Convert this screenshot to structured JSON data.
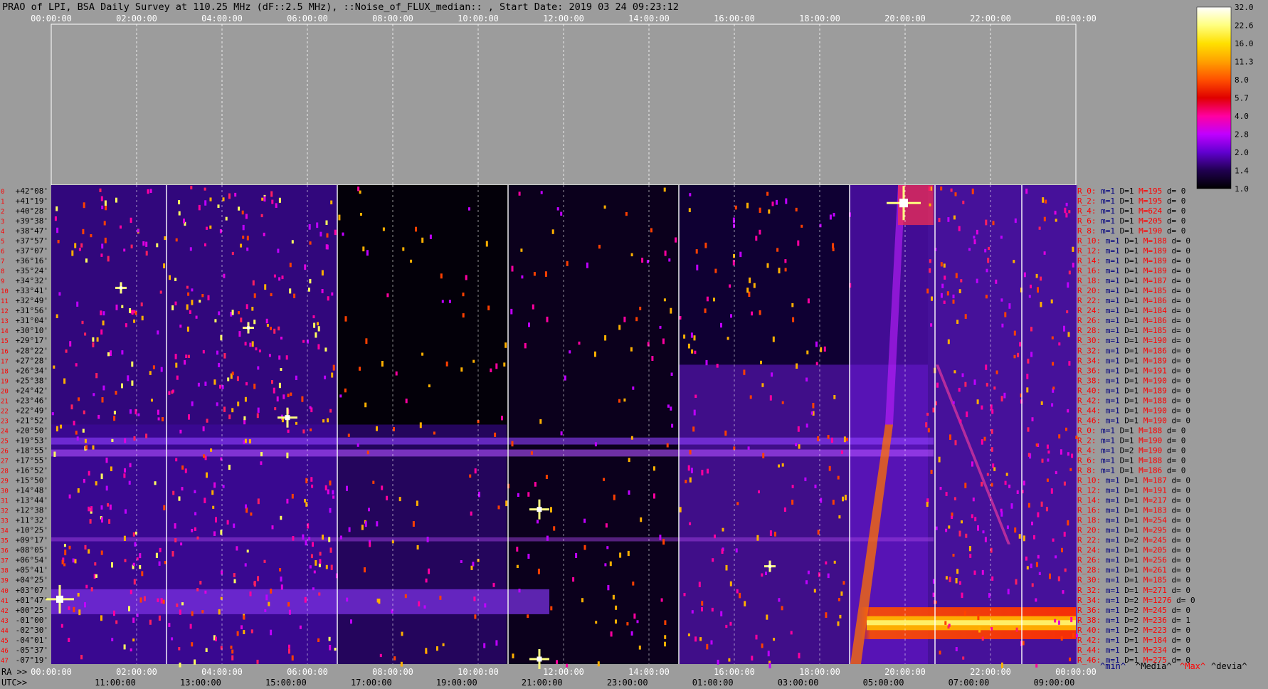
{
  "chart_data": {
    "type": "heatmap",
    "title": "PRAO of LPI, BSA Daily Survey at 110.25 MHz (dF::2.5 MHz), ::Noise_of_FLUX_median:: , Start Date: 2019 03 24 09:23:12",
    "top_ticks": [
      "00:00:00",
      "02:00:00",
      "04:00:00",
      "06:00:00",
      "08:00:00",
      "10:00:00",
      "12:00:00",
      "14:00:00",
      "16:00:00",
      "18:00:00",
      "20:00:00",
      "22:00:00",
      "00:00:00"
    ],
    "ra_prefix": "RA >>",
    "ra_ticks": [
      "00:00:00",
      "02:00:00",
      "04:00:00",
      "06:00:00",
      "08:00:00",
      "10:00:00",
      "12:00:00",
      "14:00:00",
      "16:00:00",
      "18:00:00",
      "20:00:00",
      "22:00:00",
      "00:00:00"
    ],
    "utc_prefix": "UTC>>",
    "utc_ticks": [
      "11:00:00",
      "13:00:00",
      "15:00:00",
      "17:00:00",
      "19:00:00",
      "21:00:00",
      "23:00:00",
      "01:00:00",
      "03:00:00",
      "05:00:00",
      "07:00:00",
      "09:00:00"
    ],
    "dec_labels": [
      "+42°08'",
      "+41°19'",
      "+40°28'",
      "+39°38'",
      "+38°47'",
      "+37°57'",
      "+37°07'",
      "+36°16'",
      "+35°24'",
      "+34°32'",
      "+33°41'",
      "+32°49'",
      "+31°56'",
      "+31°04'",
      "+30°10'",
      "+29°17'",
      "+28°22'",
      "+27°28'",
      "+26°34'",
      "+25°38'",
      "+24°42'",
      "+23°46'",
      "+22°49'",
      "+21°52'",
      "+20°50'",
      "+19°53'",
      "+18°55'",
      "+17°55'",
      "+16°52'",
      "+15°50'",
      "+14°48'",
      "+13°44'",
      "+12°38'",
      "+11°32'",
      "+10°25'",
      "+09°17'",
      "+08°05'",
      "+06°54'",
      "+05°41'",
      "+04°25'",
      "+03°07'",
      "+01°47'",
      "+00°25'",
      "-01°00'",
      "-02°30'",
      "-04°01'",
      "-05°37'",
      "-07°19'"
    ],
    "beam_numbers": [
      "0",
      "1",
      "2",
      "3",
      "4",
      "5",
      "6",
      "7",
      "8",
      "9",
      "10",
      "11",
      "12",
      "13",
      "14",
      "15",
      "16",
      "17",
      "18",
      "19",
      "20",
      "21",
      "22",
      "23",
      "24",
      "25",
      "26",
      "27",
      "28",
      "29",
      "30",
      "31",
      "32",
      "33",
      "34",
      "35",
      "36",
      "37",
      "38",
      "39",
      "40",
      "41",
      "42",
      "43",
      "44",
      "45",
      "46",
      "47"
    ],
    "colorbar": {
      "ticks": [
        "32.0",
        "22.6",
        "16.0",
        "11.3",
        "8.0",
        "5.7",
        "4.0",
        "2.8",
        "2.0",
        "1.4",
        "1.0"
      ],
      "colors": [
        "#ffffff",
        "#ffff80",
        "#ffe000",
        "#ffa000",
        "#ff5000",
        "#e00000",
        "#ff00a0",
        "#c000ff",
        "#6000d0",
        "#200050",
        "#000000"
      ]
    },
    "legend_footer": {
      "min": "^min^",
      "media": "^Media^",
      "max": "^Max^",
      "devia": "^devia^"
    },
    "stats": [
      {
        "label": "R_0:",
        "m": "m=1",
        "D": "D=1",
        "M": "M=195",
        "d": "d= 0"
      },
      {
        "label": "R_2:",
        "m": "m=1",
        "D": "D=1",
        "M": "M=195",
        "d": "d= 0"
      },
      {
        "label": "R_4:",
        "m": "m=1",
        "D": "D=1",
        "M": "M=624",
        "d": "d= 0"
      },
      {
        "label": "R_6:",
        "m": "m=1",
        "D": "D=1",
        "M": "M=205",
        "d": "d= 0"
      },
      {
        "label": "R_8:",
        "m": "m=1",
        "D": "D=1",
        "M": "M=190",
        "d": "d= 0"
      },
      {
        "label": "R_10:",
        "m": "m=1",
        "D": "D=1",
        "M": "M=188",
        "d": "d= 0"
      },
      {
        "label": "R_12:",
        "m": "m=1",
        "D": "D=1",
        "M": "M=189",
        "d": "d= 0"
      },
      {
        "label": "R_14:",
        "m": "m=1",
        "D": "D=1",
        "M": "M=189",
        "d": "d= 0"
      },
      {
        "label": "R_16:",
        "m": "m=1",
        "D": "D=1",
        "M": "M=189",
        "d": "d= 0"
      },
      {
        "label": "R_18:",
        "m": "m=1",
        "D": "D=1",
        "M": "M=187",
        "d": "d= 0"
      },
      {
        "label": "R_20:",
        "m": "m=1",
        "D": "D=1",
        "M": "M=185",
        "d": "d= 0"
      },
      {
        "label": "R_22:",
        "m": "m=1",
        "D": "D=1",
        "M": "M=186",
        "d": "d= 0"
      },
      {
        "label": "R_24:",
        "m": "m=1",
        "D": "D=1",
        "M": "M=184",
        "d": "d= 0"
      },
      {
        "label": "R_26:",
        "m": "m=1",
        "D": "D=1",
        "M": "M=186",
        "d": "d= 0"
      },
      {
        "label": "R_28:",
        "m": "m=1",
        "D": "D=1",
        "M": "M=185",
        "d": "d= 0"
      },
      {
        "label": "R_30:",
        "m": "m=1",
        "D": "D=1",
        "M": "M=190",
        "d": "d= 0"
      },
      {
        "label": "R_32:",
        "m": "m=1",
        "D": "D=1",
        "M": "M=186",
        "d": "d= 0"
      },
      {
        "label": "R_34:",
        "m": "m=1",
        "D": "D=1",
        "M": "M=189",
        "d": "d= 0"
      },
      {
        "label": "R_36:",
        "m": "m=1",
        "D": "D=1",
        "M": "M=191",
        "d": "d= 0"
      },
      {
        "label": "R_38:",
        "m": "m=1",
        "D": "D=1",
        "M": "M=190",
        "d": "d= 0"
      },
      {
        "label": "R_40:",
        "m": "m=1",
        "D": "D=1",
        "M": "M=189",
        "d": "d= 0"
      },
      {
        "label": "R_42:",
        "m": "m=1",
        "D": "D=1",
        "M": "M=188",
        "d": "d= 0"
      },
      {
        "label": "R_44:",
        "m": "m=1",
        "D": "D=1",
        "M": "M=190",
        "d": "d= 0"
      },
      {
        "label": "R_46:",
        "m": "m=1",
        "D": "D=1",
        "M": "M=190",
        "d": "d= 0"
      },
      {
        "label": "R_0:",
        "m": "m=1",
        "D": "D=1",
        "M": "M=188",
        "d": "d= 0"
      },
      {
        "label": "R_2:",
        "m": "m=1",
        "D": "D=1",
        "M": "M=190",
        "d": "d= 0"
      },
      {
        "label": "R_4:",
        "m": "m=1",
        "D": "D=2",
        "M": "M=190",
        "d": "d= 0"
      },
      {
        "label": "R_6:",
        "m": "m=1",
        "D": "D=1",
        "M": "M=188",
        "d": "d= 0"
      },
      {
        "label": "R_8:",
        "m": "m=1",
        "D": "D=1",
        "M": "M=186",
        "d": "d= 0"
      },
      {
        "label": "R_10:",
        "m": "m=1",
        "D": "D=1",
        "M": "M=187",
        "d": "d= 0"
      },
      {
        "label": "R_12:",
        "m": "m=1",
        "D": "D=1",
        "M": "M=191",
        "d": "d= 0"
      },
      {
        "label": "R_14:",
        "m": "m=1",
        "D": "D=1",
        "M": "M=217",
        "d": "d= 0"
      },
      {
        "label": "R_16:",
        "m": "m=1",
        "D": "D=1",
        "M": "M=183",
        "d": "d= 0"
      },
      {
        "label": "R_18:",
        "m": "m=1",
        "D": "D=1",
        "M": "M=254",
        "d": "d= 0"
      },
      {
        "label": "R_20:",
        "m": "m=1",
        "D": "D=1",
        "M": "M=295",
        "d": "d= 0"
      },
      {
        "label": "R_22:",
        "m": "m=1",
        "D": "D=2",
        "M": "M=245",
        "d": "d= 0"
      },
      {
        "label": "R_24:",
        "m": "m=1",
        "D": "D=1",
        "M": "M=205",
        "d": "d= 0"
      },
      {
        "label": "R_26:",
        "m": "m=1",
        "D": "D=1",
        "M": "M=256",
        "d": "d= 0"
      },
      {
        "label": "R_28:",
        "m": "m=1",
        "D": "D=1",
        "M": "M=261",
        "d": "d= 0"
      },
      {
        "label": "R_30:",
        "m": "m=1",
        "D": "D=1",
        "M": "M=185",
        "d": "d= 0"
      },
      {
        "label": "R_32:",
        "m": "m=1",
        "D": "D=1",
        "M": "M=271",
        "d": "d= 0"
      },
      {
        "label": "R_34:",
        "m": "m=1",
        "D": "D=2",
        "M": "M=1276",
        "d": "d= 0"
      },
      {
        "label": "R_36:",
        "m": "m=1",
        "D": "D=2",
        "M": "M=245",
        "d": "d= 0"
      },
      {
        "label": "R_38:",
        "m": "m=1",
        "D": "D=2",
        "M": "M=236",
        "d": "d= 1"
      },
      {
        "label": "R_40:",
        "m": "m=1",
        "D": "D=2",
        "M": "M=223",
        "d": "d= 0"
      },
      {
        "label": "R_42:",
        "m": "m=1",
        "D": "D=1",
        "M": "M=184",
        "d": "d= 0"
      },
      {
        "label": "R_44:",
        "m": "m=1",
        "D": "D=1",
        "M": "M=234",
        "d": "d= 0"
      },
      {
        "label": "R_46:",
        "m": "m=1",
        "D": "D=1",
        "M": "M=275",
        "d": "d= 0"
      }
    ]
  }
}
